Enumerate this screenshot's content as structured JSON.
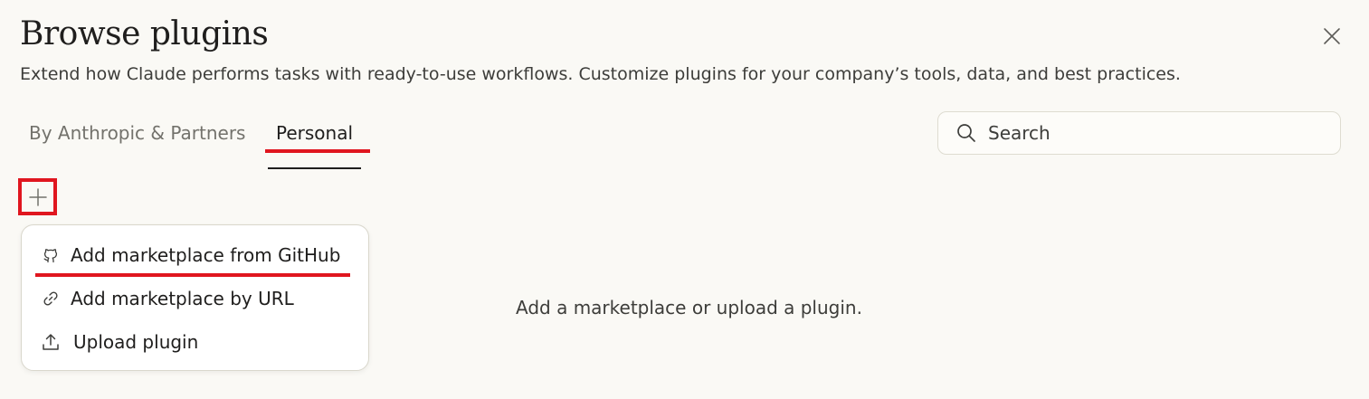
{
  "dialog": {
    "title": "Browse plugins",
    "subtitle": "Extend how Claude performs tasks with ready-to-use workflows. Customize plugins for your company’s tools, data, and best practices."
  },
  "tabs": [
    {
      "label": "By Anthropic & Partners",
      "active": false
    },
    {
      "label": "Personal",
      "active": true
    }
  ],
  "search": {
    "placeholder": "Search",
    "value": ""
  },
  "add_menu": {
    "items": [
      {
        "label": "Add marketplace from GitHub",
        "icon": "github-icon"
      },
      {
        "label": "Add marketplace by URL",
        "icon": "link-icon"
      },
      {
        "label": "Upload plugin",
        "icon": "upload-icon"
      }
    ]
  },
  "empty_state": {
    "message": "Add a marketplace or upload a plugin."
  },
  "colors": {
    "background": "#faf9f5",
    "text": "#1f1e1d",
    "muted": "#73726c",
    "annotation": "#e0161f"
  }
}
